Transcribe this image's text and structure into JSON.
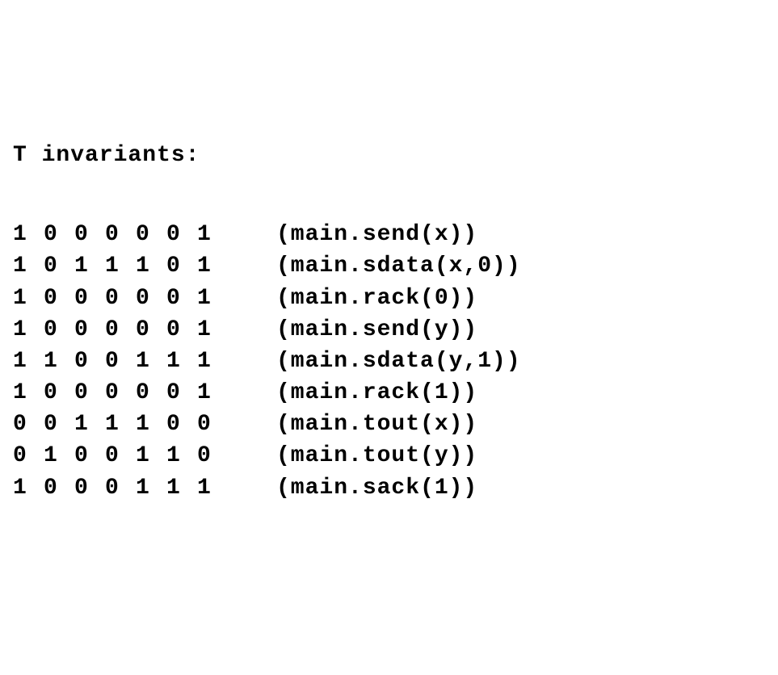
{
  "title": "T invariants:",
  "rows": [
    {
      "cells": [
        "1",
        "0",
        "0",
        "0",
        "0",
        "0",
        "1"
      ],
      "label": "(main.send(x))"
    },
    {
      "cells": [
        "1",
        "0",
        "1",
        "1",
        "1",
        "0",
        "1"
      ],
      "label": "(main.sdata(x,0))"
    },
    {
      "cells": [
        "1",
        "0",
        "0",
        "0",
        "0",
        "0",
        "1"
      ],
      "label": "(main.rack(0))"
    },
    {
      "cells": [
        "1",
        "0",
        "0",
        "0",
        "0",
        "0",
        "1"
      ],
      "label": "(main.send(y))"
    },
    {
      "cells": [
        "1",
        "1",
        "0",
        "0",
        "1",
        "1",
        "1"
      ],
      "label": "(main.sdata(y,1))"
    },
    {
      "cells": [
        "1",
        "0",
        "0",
        "0",
        "0",
        "0",
        "1"
      ],
      "label": "(main.rack(1))"
    },
    {
      "cells": [
        "0",
        "0",
        "1",
        "1",
        "1",
        "0",
        "0"
      ],
      "label": "(main.tout(x))"
    },
    {
      "cells": [
        "0",
        "1",
        "0",
        "0",
        "1",
        "1",
        "0"
      ],
      "label": "(main.tout(y))"
    },
    {
      "cells": [
        "1",
        "0",
        "0",
        "0",
        "1",
        "1",
        "1"
      ],
      "label": "(main.sack(1))"
    }
  ]
}
